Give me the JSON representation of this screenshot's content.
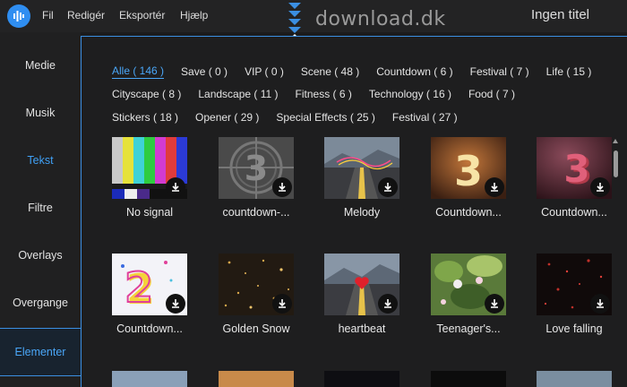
{
  "menu": {
    "app_icon": "audio-bars-icon",
    "items": [
      {
        "label": "Fil"
      },
      {
        "label": "Redigér"
      },
      {
        "label": "Eksportér"
      },
      {
        "label": "Hjælp"
      }
    ]
  },
  "watermark": "download.dk",
  "window_title": "Ingen titel",
  "sidebar": {
    "items": [
      {
        "label": "Medie"
      },
      {
        "label": "Musik"
      },
      {
        "label": "Tekst"
      },
      {
        "label": "Filtre"
      },
      {
        "label": "Overlays"
      },
      {
        "label": "Overgange"
      },
      {
        "label": "Elementer"
      }
    ]
  },
  "filters": [
    [
      {
        "label": "Alle ( 146 )"
      },
      {
        "label": "Save ( 0 )"
      },
      {
        "label": "VIP ( 0 )"
      },
      {
        "label": "Scene ( 48 )"
      },
      {
        "label": "Countdown ( 6 )"
      },
      {
        "label": "Festival ( 7 )"
      },
      {
        "label": "Life ( 15 )"
      }
    ],
    [
      {
        "label": "Cityscape ( 8 )"
      },
      {
        "label": "Landscape ( 11 )"
      },
      {
        "label": "Fitness ( 6 )"
      },
      {
        "label": "Technology ( 16 )"
      },
      {
        "label": "Food ( 7 )"
      }
    ],
    [
      {
        "label": "Stickers ( 18 )"
      },
      {
        "label": "Opener ( 29 )"
      },
      {
        "label": "Special Effects ( 25 )"
      },
      {
        "label": "Festival ( 27 )"
      }
    ]
  ],
  "tiles": [
    {
      "label": "No signal",
      "thumb": "color-bars"
    },
    {
      "label": "countdown-...",
      "thumb": "film-leader-3"
    },
    {
      "label": "Melody",
      "thumb": "road-mountains"
    },
    {
      "label": "Countdown...",
      "thumb": "gold-3"
    },
    {
      "label": "Countdown...",
      "thumb": "red-3d-3"
    },
    {
      "label": "Countdown...",
      "thumb": "white-2"
    },
    {
      "label": "Golden Snow",
      "thumb": "golden-snow"
    },
    {
      "label": "heartbeat",
      "thumb": "road-heart"
    },
    {
      "label": "Teenager's...",
      "thumb": "green-flowers"
    },
    {
      "label": "Love falling",
      "thumb": "red-dots"
    }
  ],
  "colors": {
    "accent": "#4aa6f7",
    "border": "#3b8fe2"
  }
}
